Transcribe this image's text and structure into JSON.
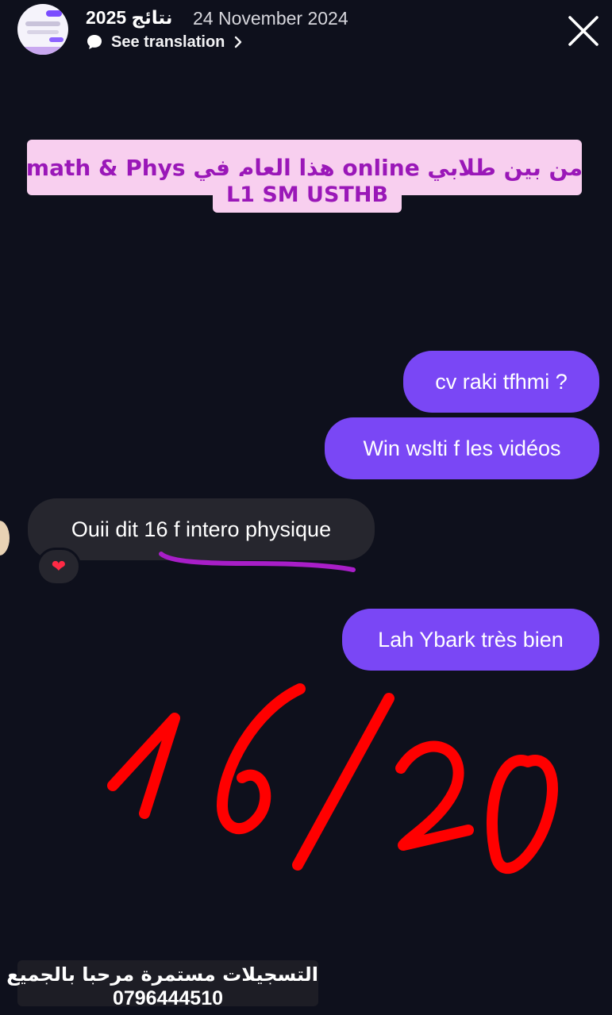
{
  "header": {
    "title": "نتائج 2025",
    "date": "24 November 2024",
    "translate_label": "See translation",
    "icons": [
      "avatar",
      "translate-bubble-icon",
      "chevron-right-icon",
      "close-icon"
    ]
  },
  "headline": {
    "line1": "من بين طلابي online هذا العام في math & Phys",
    "line2": "L1 SM USTHB",
    "color": "#9a17b8",
    "background": "#f8cfef"
  },
  "messages": [
    {
      "text": "cv raki tfhmi ?",
      "direction": "outgoing"
    },
    {
      "text": "Win wslti f les vidéos",
      "direction": "outgoing"
    },
    {
      "text": "Ouii dit 16 f intero physique",
      "direction": "incoming"
    },
    {
      "text": "Lah Ybark très bien",
      "direction": "outgoing"
    }
  ],
  "reaction": {
    "emoji": "❤",
    "icon": "heart-icon"
  },
  "score": {
    "text": "16/20",
    "color": "#ff0000"
  },
  "footer": {
    "line1": "التسجيلات مستمرة مرحبا بالجميع",
    "line2": "0796444510"
  },
  "colors": {
    "background": "#0e101c",
    "outgoing_bubble": "#7a47f5",
    "incoming_bubble": "#26262e",
    "underline": "#a81ec8"
  }
}
